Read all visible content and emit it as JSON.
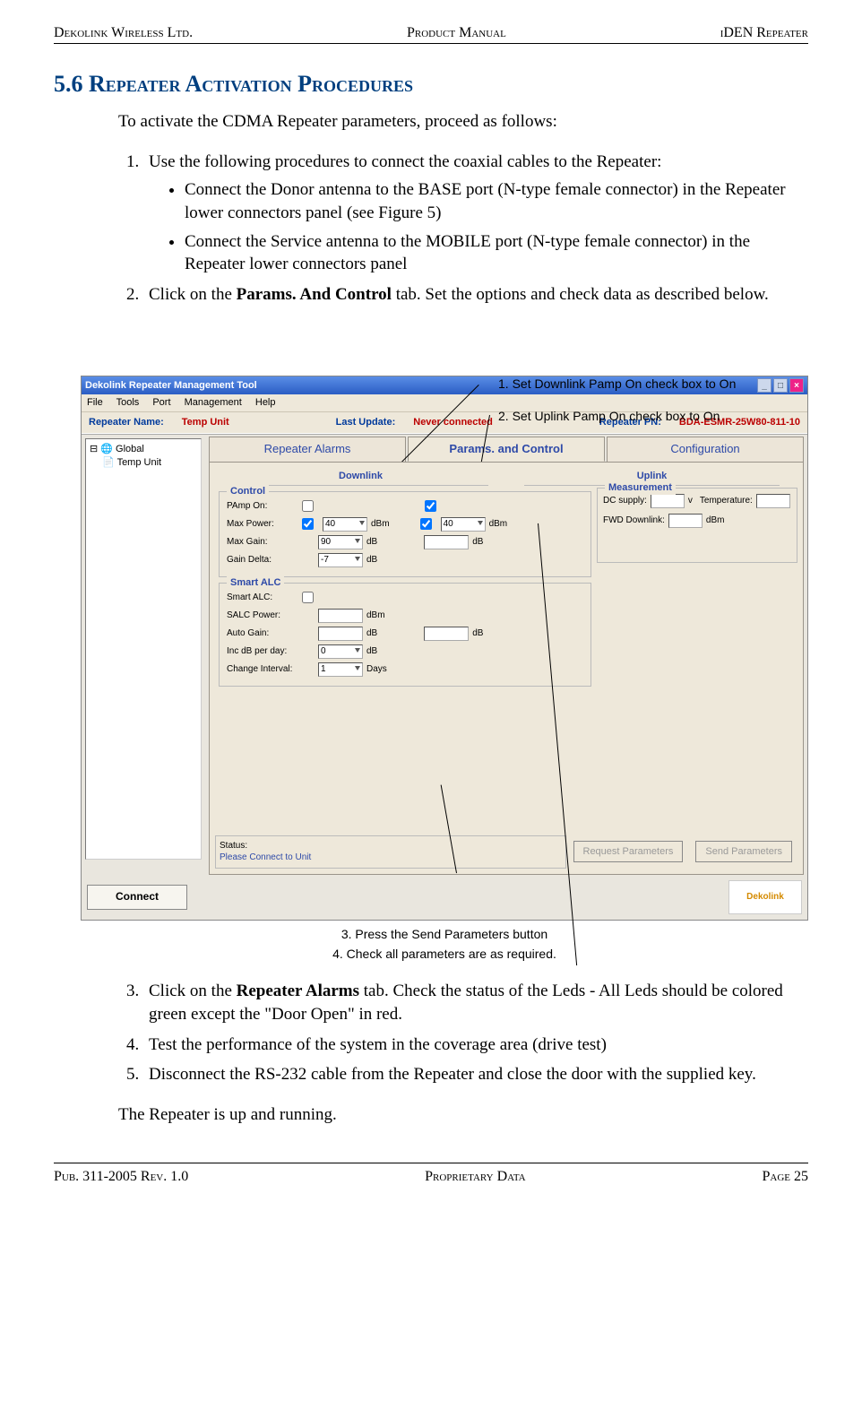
{
  "header": {
    "left": "Dekolink Wireless Ltd.",
    "center": "Product Manual",
    "right": "iDEN Repeater"
  },
  "footer": {
    "left": "Pub. 311-2005 Rev. 1.0",
    "center": "Proprietary Data",
    "right": "Page 25"
  },
  "section_number": "5.6",
  "section_title": "Repeater Activation Procedures",
  "intro": "To activate the CDMA Repeater parameters, proceed as follows:",
  "step1": "Use the following procedures to connect the coaxial cables to the Repeater:",
  "bullet1": "Connect the Donor antenna to the BASE port (N-type female connector) in the Repeater lower connectors panel (see Figure 5)",
  "bullet2": "Connect the Service antenna to the MOBILE port (N-type female connector) in the Repeater lower connectors panel",
  "step2_a": "Click on the ",
  "step2_b": "Params. And Control",
  "step2_c": " tab.  Set the options and check data as described below.",
  "step3_a": "Click on the ",
  "step3_b": "Repeater Alarms",
  "step3_c": " tab.  Check the status of the Leds - All Leds should be colored green except the \"Door Open\" in red.",
  "step4": "Test the performance of the system in the coverage area (drive test)",
  "step5": "Disconnect the RS-232 cable from the Repeater and close the door with the supplied key.",
  "closing": "The Repeater is up and running.",
  "annotations": {
    "a1": "1. Set Downlink Pamp On check box  to On",
    "a2": "2. Set Uplink Pamp On check box  to On",
    "a3": "3. Press the Send Parameters button",
    "a4": "4. Check all parameters are as required."
  },
  "app": {
    "title": "Dekolink Repeater Management Tool",
    "menu": {
      "file": "File",
      "tools": "Tools",
      "port": "Port",
      "management": "Management",
      "help": "Help"
    },
    "info": {
      "name_lbl": "Repeater Name:",
      "name_val": "Temp Unit",
      "update_lbl": "Last Update:",
      "update_val": "Never connected",
      "pn_lbl": "Repeater PN:",
      "pn_val": "BDA-ESMR-25W80-811-10"
    },
    "tabs": {
      "alarms": "Repeater Alarms",
      "params": "Params. and Control",
      "config": "Configuration"
    },
    "subcols": {
      "downlink": "Downlink",
      "uplink": "Uplink"
    },
    "tree": {
      "root": "Global",
      "child": "Temp Unit"
    },
    "control": {
      "title": "Control",
      "pamp": "PAmp On:",
      "maxpower": "Max Power:",
      "maxpower_dl": "40",
      "maxpower_ul": "40",
      "maxpower_unit": "dBm",
      "maxgain": "Max Gain:",
      "maxgain_dl": "90",
      "maxgain_unit": "dB",
      "gaindelta": "Gain Delta:",
      "gaindelta_dl": "-7",
      "gaindelta_unit": "dB"
    },
    "smartalc": {
      "title": "Smart ALC",
      "smartalc": "Smart ALC:",
      "salcpower": "SALC Power:",
      "salcpower_unit": "dBm",
      "autogain": "Auto Gain:",
      "autogain_unit": "dB",
      "incdb": "Inc dB per day:",
      "incdb_val": "0",
      "incdb_unit": "dB",
      "changeint": "Change Interval:",
      "changeint_val": "1",
      "changeint_unit": "Days"
    },
    "measurement": {
      "title": "Measurement",
      "dc": "DC supply:",
      "dc_unit": "v",
      "temp": "Temperature:",
      "fwd": "FWD Downlink:",
      "fwd_unit": "dBm"
    },
    "status": {
      "lbl": "Status:",
      "val": "Please Connect to Unit"
    },
    "buttons": {
      "request": "Request Parameters",
      "send": "Send Parameters",
      "connect": "Connect"
    },
    "logo": "Dekolink"
  }
}
